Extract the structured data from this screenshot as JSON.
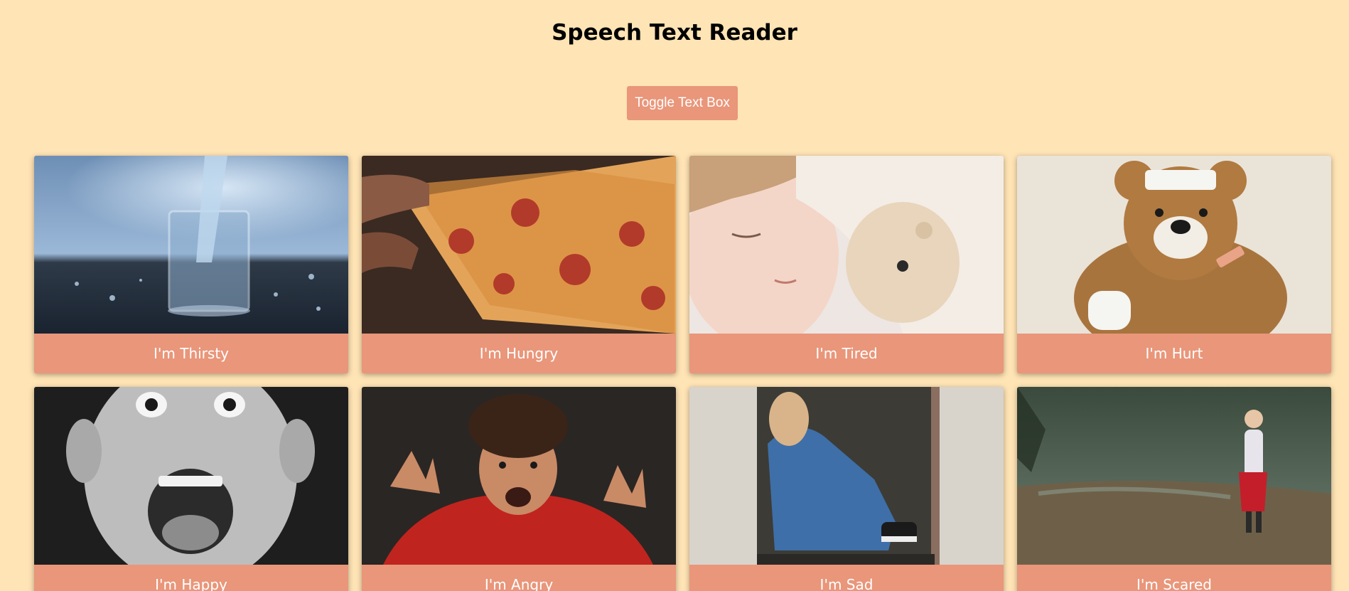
{
  "header": {
    "title": "Speech Text Reader"
  },
  "toolbar": {
    "toggle_label": "Toggle Text Box"
  },
  "colors": {
    "background": "#FFE4B5",
    "accent": "#E9967A",
    "text_light": "#FFFFFF"
  },
  "cards": [
    {
      "label": "I'm Thirsty",
      "image": "glass-of-water"
    },
    {
      "label": "I'm Hungry",
      "image": "pizza-slice"
    },
    {
      "label": "I'm Tired",
      "image": "sleeping-child-with-teddy"
    },
    {
      "label": "I'm Hurt",
      "image": "bandaged-teddy-bear"
    },
    {
      "label": "I'm Happy",
      "image": "excited-boy-face"
    },
    {
      "label": "I'm Angry",
      "image": "angry-child-red-sweater"
    },
    {
      "label": "I'm Sad",
      "image": "sad-child-in-doorway"
    },
    {
      "label": "I'm Scared",
      "image": "child-alone-in-forest"
    }
  ]
}
